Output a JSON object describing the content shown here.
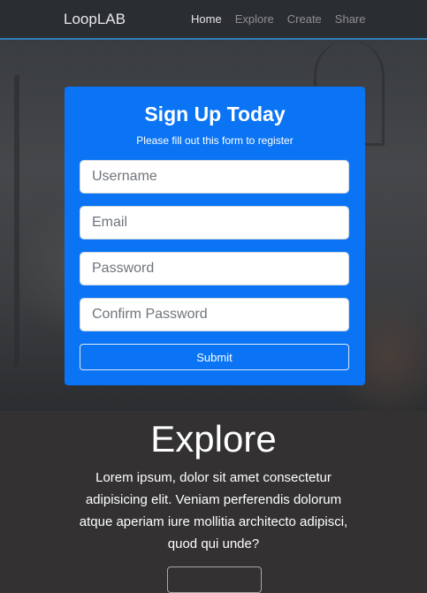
{
  "navbar": {
    "brand": "LoopLAB",
    "links": [
      {
        "label": "Home",
        "active": true
      },
      {
        "label": "Explore",
        "active": false
      },
      {
        "label": "Create",
        "active": false
      },
      {
        "label": "Share",
        "active": false
      }
    ]
  },
  "signup": {
    "title": "Sign Up Today",
    "subtitle": "Please fill out this form to register",
    "fields": {
      "username_placeholder": "Username",
      "email_placeholder": "Email",
      "password_placeholder": "Password",
      "confirm_placeholder": "Confirm Password"
    },
    "submit_label": "Submit"
  },
  "explore": {
    "title": "Explore",
    "text": "Lorem ipsum, dolor sit amet consectetur adipisicing elit. Veniam perferendis dolorum atque aperiam iure mollitia architecto adipisci, quod qui unde?"
  },
  "colors": {
    "accent": "#0a74f4",
    "navbar_border": "#2f7fb8",
    "section_bg": "#333131"
  }
}
